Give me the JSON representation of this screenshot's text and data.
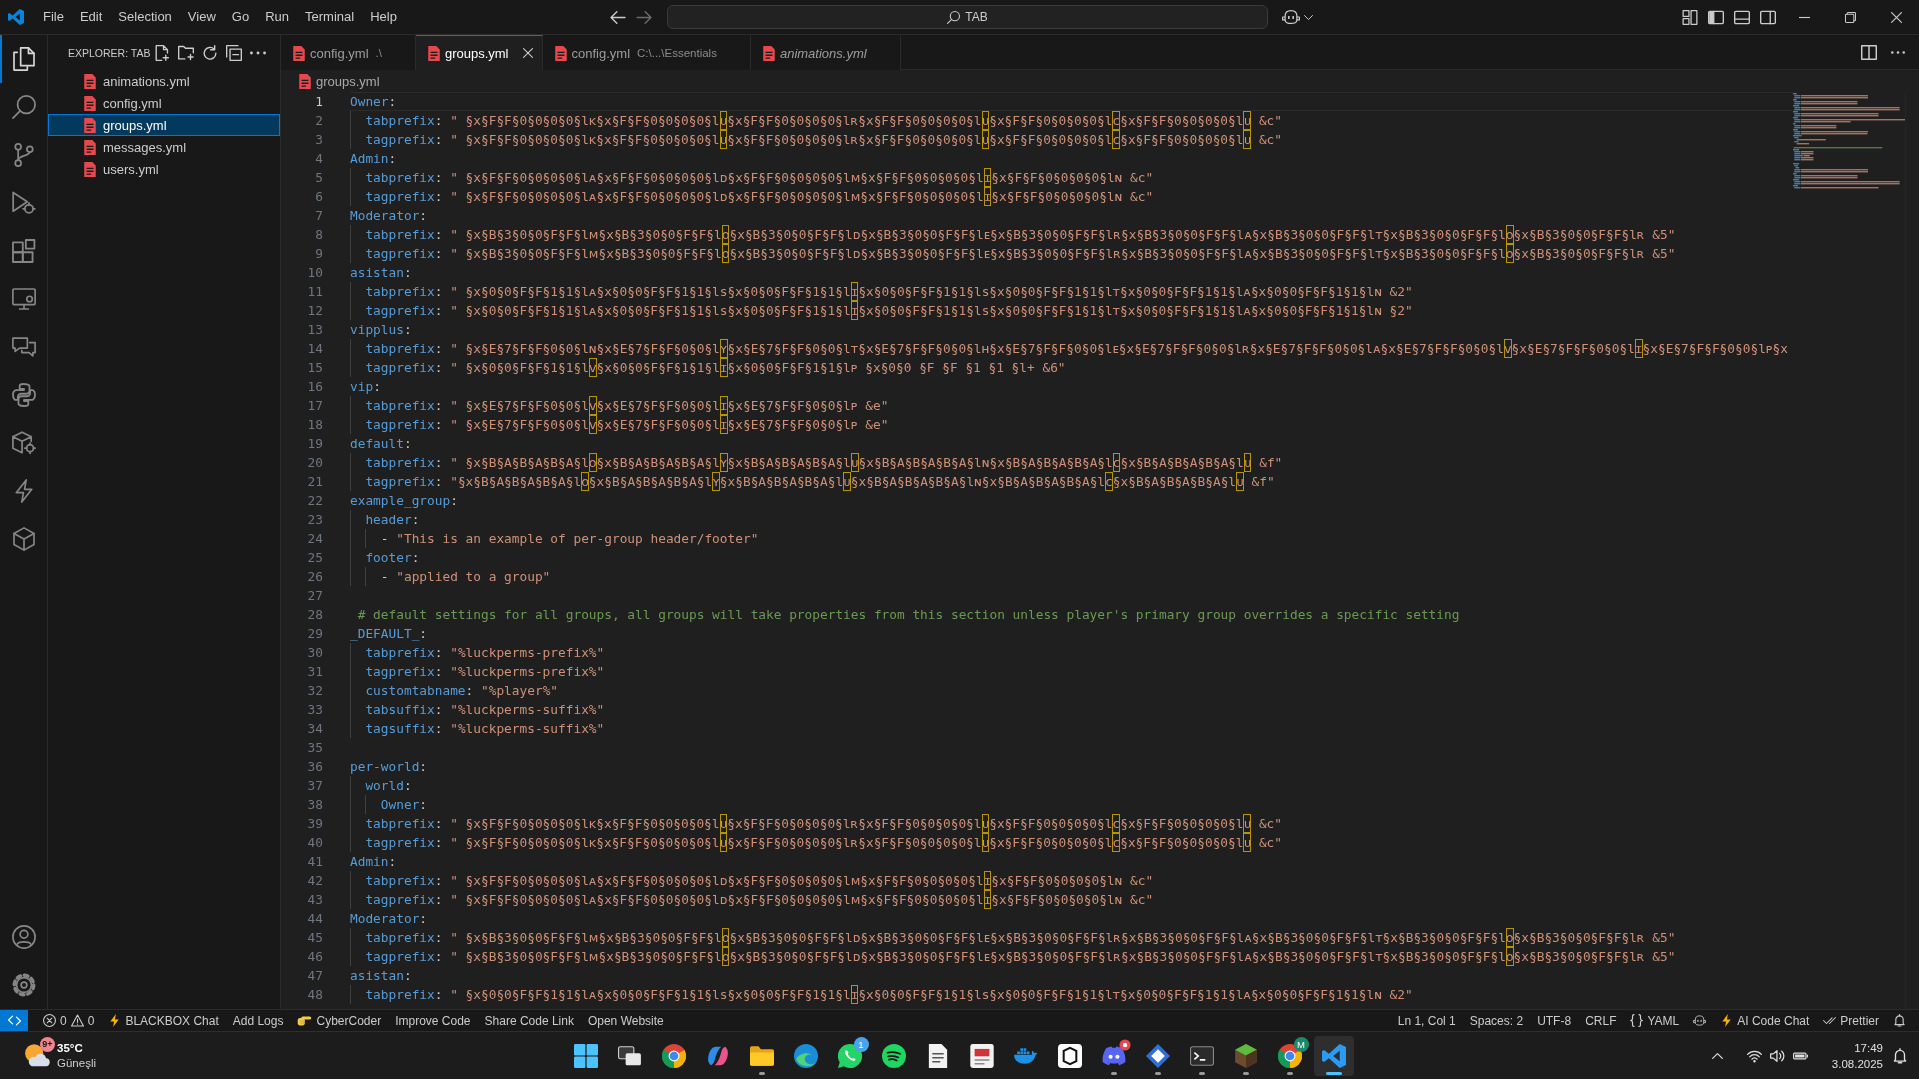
{
  "title_bar": {
    "menu": [
      "File",
      "Edit",
      "Selection",
      "View",
      "Go",
      "Run",
      "Terminal",
      "Help"
    ],
    "command_center": "TAB",
    "layout_toggles": [
      {
        "kind": "sidebar_left",
        "on": true
      },
      {
        "kind": "panel",
        "on": false
      },
      {
        "kind": "sidebar_right",
        "on": false
      }
    ]
  },
  "activity_bar": {
    "items": [
      {
        "kind": "files",
        "selected": true
      },
      {
        "kind": "search",
        "selected": false
      },
      {
        "kind": "source_control",
        "selected": false
      },
      {
        "kind": "run_debug",
        "selected": false
      },
      {
        "kind": "extensions",
        "selected": false
      },
      {
        "kind": "remote",
        "selected": false
      },
      {
        "kind": "chat",
        "selected": false
      },
      {
        "kind": "python",
        "selected": false
      },
      {
        "kind": "package",
        "selected": false
      },
      {
        "kind": "bolt",
        "selected": false
      },
      {
        "kind": "cube",
        "selected": false
      }
    ],
    "bottom": [
      {
        "kind": "account"
      },
      {
        "kind": "settings"
      }
    ]
  },
  "explorer": {
    "title": "EXPLORER: TAB",
    "files": [
      {
        "name": "animations.yml",
        "selected": false
      },
      {
        "name": "config.yml",
        "selected": false
      },
      {
        "name": "groups.yml",
        "selected": true
      },
      {
        "name": "messages.yml",
        "selected": false
      },
      {
        "name": "users.yml",
        "selected": false
      }
    ]
  },
  "tabs": [
    {
      "label": "config.yml",
      "description": ".\\",
      "selected": false,
      "preview": false
    },
    {
      "label": "groups.yml",
      "selected": true,
      "preview": false
    },
    {
      "label": "config.yml",
      "description": "C:\\...\\Essentials",
      "selected": false,
      "preview": false
    },
    {
      "label": "animations.yml",
      "selected": false,
      "preview": true
    }
  ],
  "breadcrumb": [
    "groups.yml"
  ],
  "editor": {
    "lines": [
      {
        "number": "1",
        "kind": "key",
        "key": "Owner:",
        "current": true,
        "children": [
          {
            "number": "2",
            "kind": "pair",
            "key": "tabprefix:",
            "value": "\" §x§F§F§0§0§0§0§lᴋ§x§F§F§0§0§0§0§lᴜ§x§F§F§0§0§0§0§lʀ§x§F§F§0§0§0§0§lᴜ§x§F§F§0§0§0§0§lᴄ§x§F§F§0§0§0§0§lᴜ &c\"",
            "current": false
          },
          {
            "number": "3",
            "kind": "pair",
            "key": "tagprefix:",
            "value": "\" §x§F§F§0§0§0§0§lᴋ§x§F§F§0§0§0§0§lᴜ§x§F§F§0§0§0§0§lʀ§x§F§F§0§0§0§0§lᴜ§x§F§F§0§0§0§0§lᴄ§x§F§F§0§0§0§0§lᴜ &c\"",
            "current": false
          }
        ]
      },
      {
        "number": "4",
        "kind": "key",
        "key": "Admin:",
        "current": false,
        "children": [
          {
            "number": "5",
            "kind": "pair",
            "key": "tabprefix:",
            "value": "\" §x§F§F§0§0§0§0§lᴀ§x§F§F§0§0§0§0§lᴅ§x§F§F§0§0§0§0§lᴍ§x§F§F§0§0§0§0§lɪ§x§F§F§0§0§0§0§lɴ &c\"",
            "current": false
          },
          {
            "number": "6",
            "kind": "pair",
            "key": "tagprefix:",
            "value": "\" §x§F§F§0§0§0§0§lᴀ§x§F§F§0§0§0§0§lᴅ§x§F§F§0§0§0§0§lᴍ§x§F§F§0§0§0§0§lɪ§x§F§F§0§0§0§0§lɴ &c\"",
            "current": false
          }
        ]
      },
      {
        "number": "7",
        "kind": "key",
        "key": "Moderator:",
        "current": false,
        "children": [
          {
            "number": "8",
            "kind": "pair",
            "key": "tabprefix:",
            "value": "\" §x§B§3§0§0§F§F§lᴍ§x§B§3§0§0§F§F§lᴏ§x§B§3§0§0§F§F§lᴅ§x§B§3§0§0§F§F§lᴇ§x§B§3§0§0§F§F§lʀ§x§B§3§0§0§F§F§lᴀ§x§B§3§0§0§F§F§lᴛ§x§B§3§0§0§F§F§lᴏ§x§B§3§0§0§F§F§lʀ &5\"",
            "current": false
          },
          {
            "number": "9",
            "kind": "pair",
            "key": "tagprefix:",
            "value": "\" §x§B§3§0§0§F§F§lᴍ§x§B§3§0§0§F§F§lᴏ§x§B§3§0§0§F§F§lᴅ§x§B§3§0§0§F§F§lᴇ§x§B§3§0§0§F§F§lʀ§x§B§3§0§0§F§F§lᴀ§x§B§3§0§0§F§F§lᴛ§x§B§3§0§0§F§F§lᴏ§x§B§3§0§0§F§F§lʀ &5\"",
            "current": false
          }
        ]
      },
      {
        "number": "10",
        "kind": "key",
        "key": "asistan:",
        "current": false,
        "children": [
          {
            "number": "11",
            "kind": "pair",
            "key": "tabprefix:",
            "value": "\" §x§0§0§F§F§1§1§lᴀ§x§0§0§F§F§1§1§ls§x§0§0§F§F§1§1§lɪ§x§0§0§F§F§1§1§ls§x§0§0§F§F§1§1§lᴛ§x§0§0§F§F§1§1§lᴀ§x§0§0§F§F§1§1§lɴ &2\"",
            "current": false
          },
          {
            "number": "12",
            "kind": "pair",
            "key": "tagprefix:",
            "value": "\" §x§0§0§F§F§1§1§lᴀ§x§0§0§F§F§1§1§ls§x§0§0§F§F§1§1§lɪ§x§0§0§F§F§1§1§ls§x§0§0§F§F§1§1§lᴛ§x§0§0§F§F§1§1§lᴀ§x§0§0§F§F§1§1§lɴ §2\"",
            "current": false
          }
        ]
      },
      {
        "number": "13",
        "kind": "key",
        "key": "vipplus:",
        "current": false,
        "children": [
          {
            "number": "14",
            "kind": "pair",
            "key": "tabprefix:",
            "value": "\" §x§E§7§F§F§0§0§lɴ§x§E§7§F§F§0§0§lʏ§x§E§7§F§F§0§0§lᴛ§x§E§7§F§F§0§0§lʜ§x§E§7§F§F§0§0§lᴇ§x§E§7§F§F§0§0§lʀ§x§E§7§F§F§0§0§lᴀ§x§E§7§F§F§0§0§lᴠ§x§E§7§F§F§0§0§lɪ§x§E§7§F§F§0§0§lᴘ§x",
            "current": false
          },
          {
            "number": "15",
            "kind": "pair",
            "key": "tagprefix:",
            "value": "\" §x§0§0§F§F§1§1§lᴠ§x§0§0§F§F§1§1§lɪ§x§0§0§F§F§1§1§lᴘ §x§0§0 §F §F §1 §1 §l+ &6\"",
            "current": false
          }
        ]
      },
      {
        "number": "16",
        "kind": "key",
        "key": "vip:",
        "current": false,
        "children": [
          {
            "number": "17",
            "kind": "pair",
            "key": "tabprefix:",
            "value": "\" §x§E§7§F§F§0§0§lᴠ§x§E§7§F§F§0§0§lɪ§x§E§7§F§F§0§0§lᴘ &e\"",
            "current": false
          },
          {
            "number": "18",
            "kind": "pair",
            "key": "tagprefix:",
            "value": "\" §x§E§7§F§F§0§0§lᴠ§x§E§7§F§F§0§0§lɪ§x§E§7§F§F§0§0§lᴘ &e\"",
            "current": false
          }
        ]
      },
      {
        "number": "19",
        "kind": "key",
        "key": "default:",
        "current": false,
        "children": [
          {
            "number": "20",
            "kind": "pair",
            "key": "tabprefix:",
            "value": "\" §x§B§A§B§A§B§A§lᴏ§x§B§A§B§A§B§A§lʏ§x§B§A§B§A§B§A§lᴜ§x§B§A§B§A§B§A§lɴ§x§B§A§B§A§B§A§lᴄ§x§B§A§B§A§B§A§lᴜ &f\"",
            "current": false
          },
          {
            "number": "21",
            "kind": "pair",
            "key": "tagprefix:",
            "value": "\"§x§B§A§B§A§B§A§lᴏ§x§B§A§B§A§B§A§lʏ§x§B§A§B§A§B§A§lᴜ§x§B§A§B§A§B§A§lɴ§x§B§A§B§A§B§A§lᴄ§x§B§A§B§A§B§A§lᴜ &f\"",
            "current": false
          }
        ]
      },
      {
        "number": "22",
        "kind": "key",
        "key": "example_group:",
        "current": false,
        "children": [
          {
            "number": "23",
            "kind": "key",
            "key": "header:",
            "current": false,
            "children": [
              {
                "number": "24",
                "kind": "item",
                "bullet": "-",
                "value": "\"This is an example of per-group header/footer\"",
                "current": false
              }
            ]
          },
          {
            "number": "25",
            "kind": "key",
            "key": "footer:",
            "current": false,
            "children": [
              {
                "number": "26",
                "kind": "item",
                "bullet": "-",
                "value": "\"applied to a group\"",
                "current": false
              }
            ]
          }
        ]
      },
      {
        "number": "27",
        "kind": "blank",
        "current": false
      },
      {
        "number": "28",
        "kind": "comment",
        "text": " # default settings for all groups, all groups will take properties from this section unless player's primary group overrides a specific setting",
        "current": false
      },
      {
        "number": "29",
        "kind": "key",
        "key": "_DEFAULT_:",
        "current": false,
        "children": [
          {
            "number": "30",
            "kind": "pair",
            "key": "tabprefix:",
            "value": "\"%luckperms-prefix%\"",
            "current": false
          },
          {
            "number": "31",
            "kind": "pair",
            "key": "tagprefix:",
            "value": "\"%luckperms-prefix%\"",
            "current": false
          },
          {
            "number": "32",
            "kind": "pair",
            "key": "customtabname:",
            "value": "\"%player%\"",
            "current": false
          },
          {
            "number": "33",
            "kind": "pair",
            "key": "tabsuffix:",
            "value": "\"%luckperms-suffix%\"",
            "current": false
          },
          {
            "number": "34",
            "kind": "pair",
            "key": "tagsuffix:",
            "value": "\"%luckperms-suffix%\"",
            "current": false
          }
        ]
      },
      {
        "number": "35",
        "kind": "blank",
        "current": false
      },
      {
        "number": "36",
        "kind": "key",
        "key": "per-world:",
        "current": false,
        "children": [
          {
            "number": "37",
            "kind": "key",
            "key": "world:",
            "current": false,
            "children": [
              {
                "number": "38",
                "kind": "key",
                "key": "Owner:",
                "current": false
              }
            ]
          },
          {
            "number": "39",
            "kind": "pair",
            "key": "tabprefix:",
            "value": "\" §x§F§F§0§0§0§0§lᴋ§x§F§F§0§0§0§0§lᴜ§x§F§F§0§0§0§0§lʀ§x§F§F§0§0§0§0§lᴜ§x§F§F§0§0§0§0§lᴄ§x§F§F§0§0§0§0§lᴜ &c\"",
            "current": false
          },
          {
            "number": "40",
            "kind": "pair",
            "key": "tagprefix:",
            "value": "\" §x§F§F§0§0§0§0§lᴋ§x§F§F§0§0§0§0§lᴜ§x§F§F§0§0§0§0§lʀ§x§F§F§0§0§0§0§lᴜ§x§F§F§0§0§0§0§lᴄ§x§F§F§0§0§0§0§lᴜ &c\"",
            "current": false
          }
        ]
      },
      {
        "number": "41",
        "kind": "key",
        "key": "Admin:",
        "current": false,
        "children": [
          {
            "number": "42",
            "kind": "pair",
            "key": "tabprefix:",
            "value": "\" §x§F§F§0§0§0§0§lᴀ§x§F§F§0§0§0§0§lᴅ§x§F§F§0§0§0§0§lᴍ§x§F§F§0§0§0§0§lɪ§x§F§F§0§0§0§0§lɴ &c\"",
            "current": false
          },
          {
            "number": "43",
            "kind": "pair",
            "key": "tagprefix:",
            "value": "\" §x§F§F§0§0§0§0§lᴀ§x§F§F§0§0§0§0§lᴅ§x§F§F§0§0§0§0§lᴍ§x§F§F§0§0§0§0§lɪ§x§F§F§0§0§0§0§lɴ &c\"",
            "current": false
          }
        ]
      },
      {
        "number": "44",
        "kind": "key",
        "key": "Moderator:",
        "current": false,
        "children": [
          {
            "number": "45",
            "kind": "pair",
            "key": "tabprefix:",
            "value": "\" §x§B§3§0§0§F§F§lᴍ§x§B§3§0§0§F§F§lᴏ§x§B§3§0§0§F§F§lᴅ§x§B§3§0§0§F§F§lᴇ§x§B§3§0§0§F§F§lʀ§x§B§3§0§0§F§F§lᴀ§x§B§3§0§0§F§F§lᴛ§x§B§3§0§0§F§F§lᴏ§x§B§3§0§0§F§F§lʀ &5\"",
            "current": false
          },
          {
            "number": "46",
            "kind": "pair",
            "key": "tagprefix:",
            "value": "\" §x§B§3§0§0§F§F§lᴍ§x§B§3§0§0§F§F§lᴏ§x§B§3§0§0§F§F§lᴅ§x§B§3§0§0§F§F§lᴇ§x§B§3§0§0§F§F§lʀ§x§B§3§0§0§F§F§lᴀ§x§B§3§0§0§F§F§lᴛ§x§B§3§0§0§F§F§lᴏ§x§B§3§0§0§F§F§lʀ &5\"",
            "current": false
          }
        ]
      },
      {
        "number": "47",
        "kind": "key",
        "key": "asistan:",
        "current": false,
        "children": [
          {
            "number": "48",
            "kind": "pair",
            "key": "tabprefix:",
            "value": "\" §x§0§0§F§F§1§1§lᴀ§x§0§0§F§F§1§1§ls§x§0§0§F§F§1§1§lɪ§x§0§0§F§F§1§1§ls§x§0§0§F§F§1§1§lᴛ§x§0§0§F§F§1§1§lᴀ§x§0§0§F§F§1§1§lɴ &2\"",
            "current": false
          }
        ]
      }
    ]
  },
  "status_bar": {
    "left": [
      {
        "kind": "remote"
      },
      {
        "kind": "problems",
        "errors": "0",
        "warnings": "0"
      },
      {
        "kind": "bolt",
        "text": "BLACKBOX Chat"
      },
      {
        "kind": "text",
        "text": "Add Logs"
      },
      {
        "kind": "hand",
        "text": "CyberCoder"
      },
      {
        "kind": "text",
        "text": "Improve Code"
      },
      {
        "kind": "text",
        "text": "Share Code Link"
      },
      {
        "kind": "text",
        "text": "Open Website"
      }
    ],
    "right": [
      {
        "kind": "text",
        "text": "Ln 1, Col 1"
      },
      {
        "kind": "text",
        "text": "Spaces: 2"
      },
      {
        "kind": "text",
        "text": "UTF-8"
      },
      {
        "kind": "text",
        "text": "CRLF"
      },
      {
        "kind": "braces",
        "text": "YAML"
      },
      {
        "kind": "robot"
      },
      {
        "kind": "bolt",
        "text": "AI Code Chat"
      },
      {
        "kind": "double_check",
        "text": "Prettier"
      },
      {
        "kind": "bell"
      }
    ]
  },
  "taskbar": {
    "weather": {
      "badge": {
        "text": "9+",
        "color": "#f0848f"
      },
      "temperature": "35°C",
      "condition": "Güneşli"
    },
    "apps": [
      {
        "kind": "start",
        "running": false,
        "selected": false,
        "alert": false
      },
      {
        "kind": "task_view",
        "running": false,
        "selected": false,
        "alert": false
      },
      {
        "kind": "ring",
        "running": false,
        "selected": false,
        "alert": false
      },
      {
        "kind": "swirl",
        "running": false,
        "selected": false,
        "alert": false
      },
      {
        "kind": "folder",
        "running": true,
        "selected": false,
        "alert": false
      },
      {
        "kind": "wave",
        "running": false,
        "selected": false,
        "alert": false
      },
      {
        "kind": "chat",
        "running": false,
        "selected": false,
        "alert": false,
        "badge": {
          "text": "1",
          "color": "#4aa3f0"
        }
      },
      {
        "kind": "arcs",
        "running": false,
        "selected": false,
        "alert": false
      },
      {
        "kind": "document",
        "running": false,
        "selected": false,
        "alert": false
      },
      {
        "kind": "slides",
        "running": false,
        "selected": false,
        "alert": false
      },
      {
        "kind": "whale",
        "running": false,
        "selected": false,
        "alert": false
      },
      {
        "kind": "tile",
        "running": false,
        "selected": false,
        "alert": false
      },
      {
        "kind": "gamepad",
        "running": true,
        "selected": false,
        "alert": true
      },
      {
        "kind": "diamond",
        "running": true,
        "selected": false,
        "alert": false
      },
      {
        "kind": "terminal",
        "running": true,
        "selected": false,
        "alert": false
      },
      {
        "kind": "block",
        "running": true,
        "selected": false,
        "alert": false
      },
      {
        "kind": "ring",
        "running": true,
        "selected": false,
        "alert": false,
        "badge": {
          "text": "M",
          "color": "#1a8a6a"
        }
      },
      {
        "kind": "ribbon",
        "running": true,
        "selected": true,
        "alert": false
      }
    ],
    "clock": {
      "time": "17:49",
      "date": "3.08.2025"
    }
  }
}
